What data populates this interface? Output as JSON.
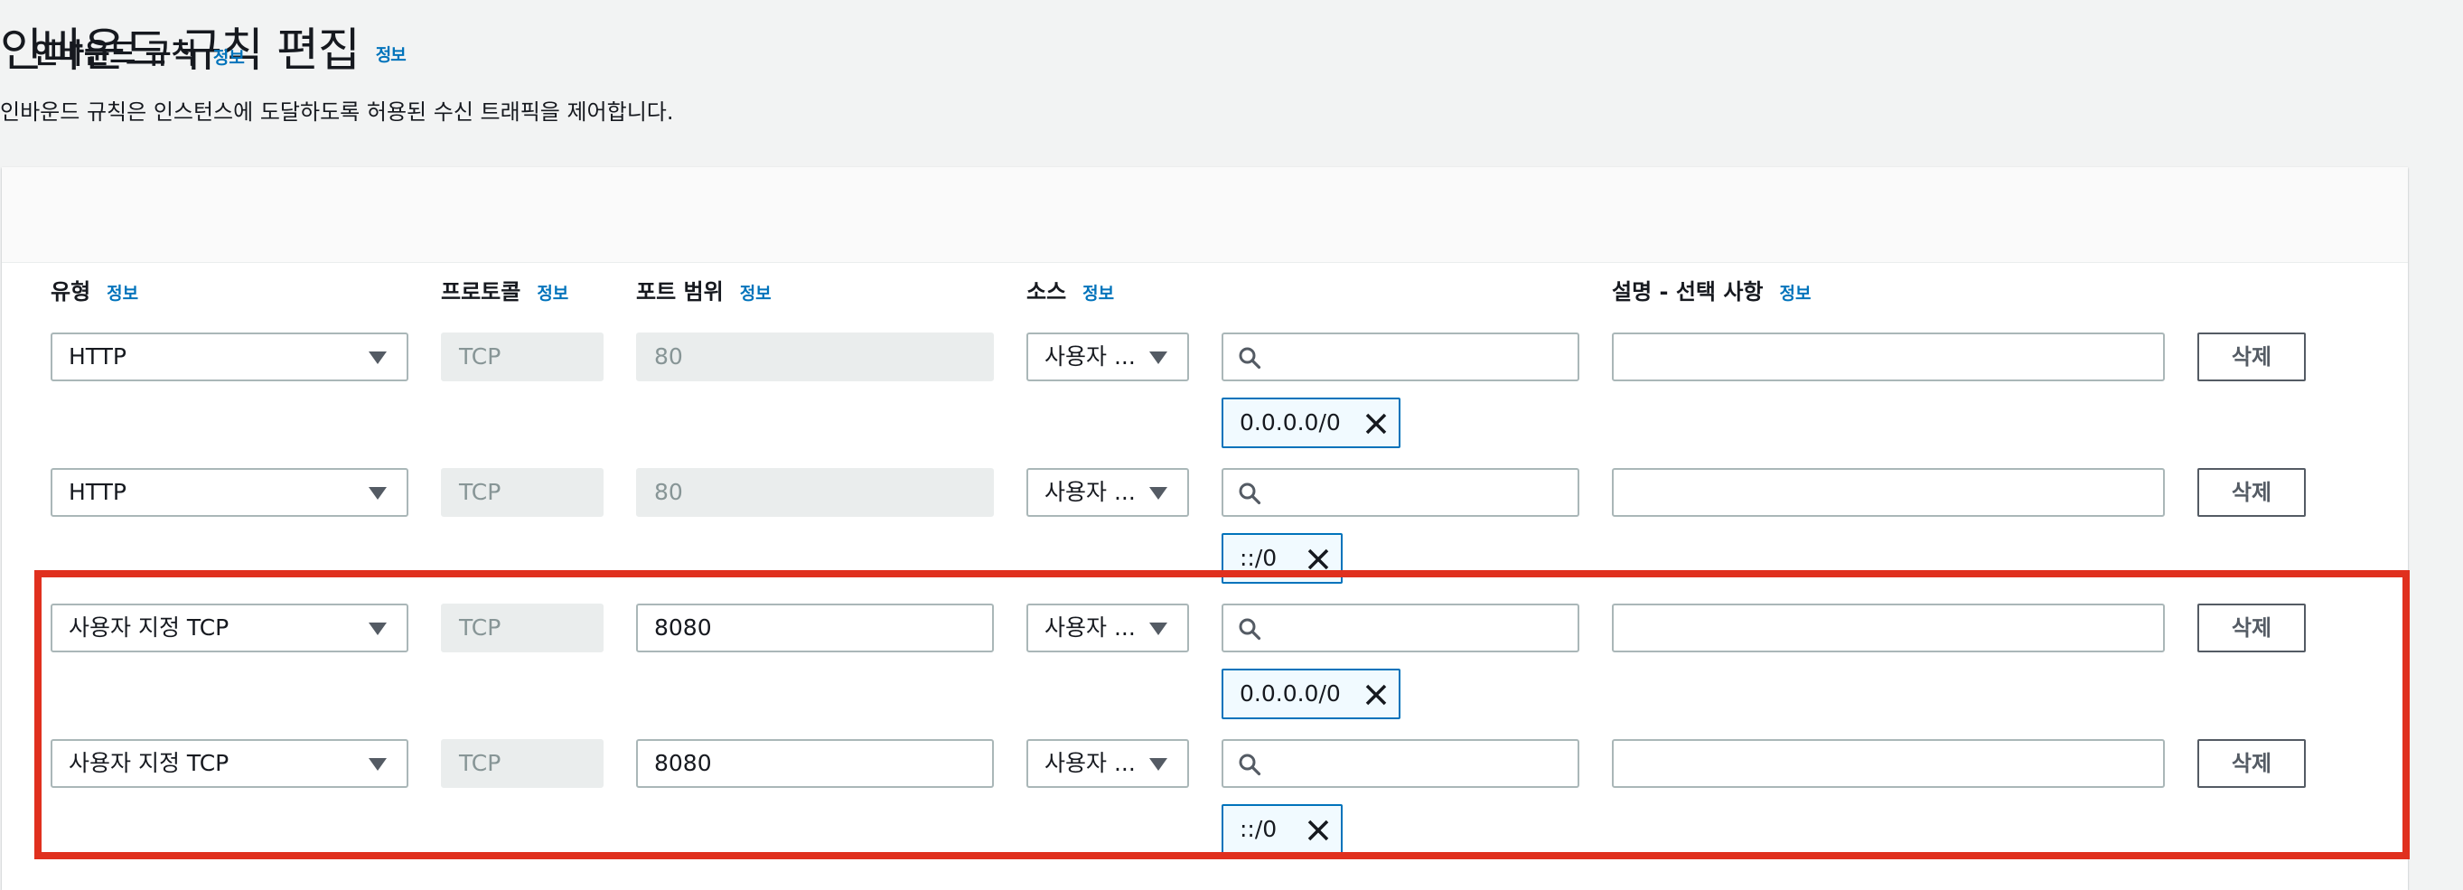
{
  "page": {
    "title": "인바운드 규칙 편집",
    "title_info": "정보",
    "description": "인바운드 규칙은 인스턴스에 도달하도록 허용된 수신 트래픽을 제어합니다."
  },
  "panel": {
    "title": "인바운드 규칙",
    "title_info": "정보",
    "columns": {
      "type": "유형",
      "protocol": "프로토콜",
      "port_range": "포트 범위",
      "source": "소스",
      "description": "설명 - 선택 사항",
      "info": "정보"
    }
  },
  "rules": [
    {
      "type": "HTTP",
      "protocol": "TCP",
      "port": "80",
      "source_type": "사용자 ...",
      "cidr": "0.0.0.0/0",
      "delete": "삭제"
    },
    {
      "type": "HTTP",
      "protocol": "TCP",
      "port": "80",
      "source_type": "사용자 ...",
      "cidr": "::/0",
      "delete": "삭제"
    },
    {
      "type": "사용자 지정 TCP",
      "protocol": "TCP",
      "port": "8080",
      "source_type": "사용자 ...",
      "cidr": "0.0.0.0/0",
      "delete": "삭제"
    },
    {
      "type": "사용자 지정 TCP",
      "protocol": "TCP",
      "port": "8080",
      "source_type": "사용자 ...",
      "cidr": "::/0",
      "delete": "삭제"
    }
  ],
  "colors": {
    "accent": "#0073bb",
    "highlight": "#e0301e",
    "token_bg": "#f1faff"
  },
  "icons": [
    "search-icon",
    "dropdown-caret-icon",
    "remove-token-icon"
  ]
}
